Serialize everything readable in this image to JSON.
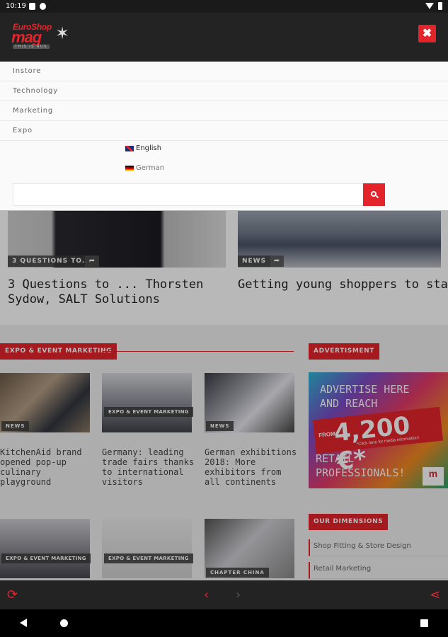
{
  "status_bar": {
    "time": "10:19"
  },
  "header": {
    "logo_top": "EuroShop",
    "logo_main": "mag",
    "logo_tagline": "THIS IS RUS",
    "close_glyph": "✖"
  },
  "menu": {
    "items": [
      "Instore",
      "Technology",
      "Marketing",
      "Expo"
    ],
    "languages": [
      {
        "flag": "uk-flag",
        "label": "English"
      },
      {
        "flag": "de-flag",
        "label": "German"
      }
    ],
    "search": {
      "value": "",
      "placeholder": ""
    }
  },
  "top_cards": [
    {
      "tag": "3 QUESTIONS TO...",
      "title": "3 Questions to ... Thorsten Sydow, SALT Solutions"
    },
    {
      "tag": "NEWS",
      "title": "Getting young shoppers to stay"
    }
  ],
  "sections": {
    "expo": "EXPO & EVENT MARKETING",
    "advertisment": "ADVERTISMENT",
    "dimensions": "OUR DIMENSIONS"
  },
  "expo_articles": [
    {
      "tag": "NEWS",
      "title": "KitchenAid brand opened pop-up culinary playground"
    },
    {
      "tag": "EXPO & EVENT MARKETING",
      "title": "Germany: leading trade fairs thanks to international visitors"
    },
    {
      "tag": "NEWS",
      "title": "German exhibitions 2018: More exhibitors from all continents"
    },
    {
      "tag": "EXPO & EVENT MARKETING",
      "title": ""
    },
    {
      "tag": "EXPO & EVENT MARKETING",
      "title": ""
    },
    {
      "tag": "CHAPTER CHINA",
      "title": ""
    }
  ],
  "ad": {
    "line1": "ADVERTISE HERE",
    "line2": "AND REACH",
    "from": "FROM",
    "price": "4,200 €*",
    "click": "*Click here for media information!",
    "line3": "RETAIL",
    "line4": "PROFESSIONALS!",
    "brand": "m"
  },
  "dimensions": [
    "Shop Fitting & Store Design",
    "Retail Marketing"
  ],
  "colors": {
    "accent": "#e4242b",
    "header": "#232323"
  }
}
